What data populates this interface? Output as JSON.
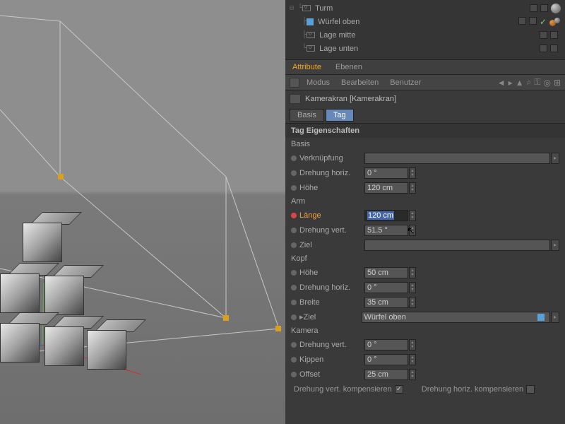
{
  "hierarchy": {
    "items": [
      {
        "name": "Turm",
        "indent": 1,
        "icon": "layer",
        "extra": "sphere"
      },
      {
        "name": "Würfel oben",
        "indent": 2,
        "icon": "cube",
        "extra": "two-sphere",
        "check": true
      },
      {
        "name": "Lage mitte",
        "indent": 2,
        "icon": "layer"
      },
      {
        "name": "Lage unten",
        "indent": 2,
        "icon": "layer"
      }
    ]
  },
  "tabs": {
    "attribute": "Attribute",
    "ebenen": "Ebenen"
  },
  "menu": {
    "modus": "Modus",
    "bearbeiten": "Bearbeiten",
    "benutzer": "Benutzer"
  },
  "object": {
    "name": "Kamerakran [Kamerakran]"
  },
  "subtabs": {
    "basis": "Basis",
    "tag": "Tag"
  },
  "section": {
    "title": "Tag Eigenschaften"
  },
  "groups": {
    "basis": "Basis",
    "arm": "Arm",
    "kopf": "Kopf",
    "kamera": "Kamera"
  },
  "props": {
    "basis": {
      "verknuepfung": {
        "label": "Verknüpfung",
        "value": ""
      },
      "drehung_horiz": {
        "label": "Drehung horiz.",
        "value": "0 °"
      },
      "hoehe": {
        "label": "Höhe",
        "value": "120 cm"
      }
    },
    "arm": {
      "laenge": {
        "label": "Länge",
        "value": "120 cm"
      },
      "drehung_vert": {
        "label": "Drehung vert.",
        "value": "51.5 °"
      },
      "ziel": {
        "label": "Ziel",
        "value": ""
      }
    },
    "kopf": {
      "hoehe": {
        "label": "Höhe",
        "value": "50 cm"
      },
      "drehung_horiz": {
        "label": "Drehung horiz.",
        "value": "0 °"
      },
      "breite": {
        "label": "Breite",
        "value": "35 cm"
      },
      "ziel": {
        "label": "Ziel",
        "value": "Würfel oben"
      }
    },
    "kamera": {
      "drehung_vert": {
        "label": "Drehung vert.",
        "value": "0 °"
      },
      "kippen": {
        "label": "Kippen",
        "value": "0 °"
      },
      "offset": {
        "label": "Offset",
        "value": "25 cm"
      },
      "comp_vert": {
        "label": "Drehung vert. kompensieren",
        "checked": true
      },
      "comp_horiz": {
        "label": "Drehung horiz. kompensieren",
        "checked": false
      }
    }
  }
}
